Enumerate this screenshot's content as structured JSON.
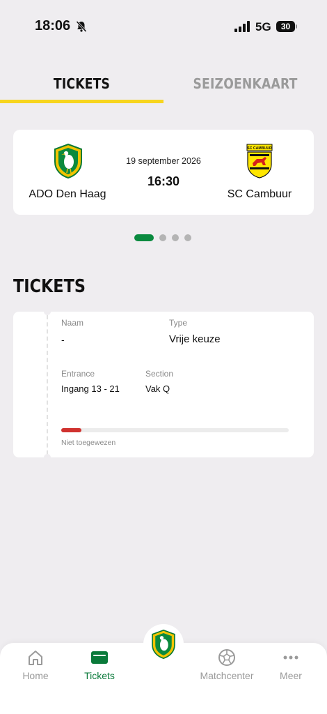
{
  "status_bar": {
    "time": "18:06",
    "network": "5G",
    "battery": "30",
    "icons": [
      "bell-slash-icon",
      "signal-icon",
      "battery-icon"
    ]
  },
  "tabs": [
    {
      "label": "TICKETS",
      "active": true
    },
    {
      "label": "SEIZOENKAART",
      "active": false
    }
  ],
  "match": {
    "home_team": "ADO Den Haag",
    "away_team": "SC Cambuur",
    "date": "19 september 2026",
    "time": "16:30",
    "away_logo_text": "SC CAMBUUR"
  },
  "pagination": {
    "count": 4,
    "active": 0
  },
  "tickets_section": {
    "title": "TICKETS",
    "ticket": {
      "naam_label": "Naam",
      "naam_value": "-",
      "type_label": "Type",
      "type_value": "Vrije keuze",
      "entrance_label": "Entrance",
      "entrance_value": "Ingang 13 - 21",
      "section_label": "Section",
      "section_value": "Vak Q",
      "progress_fraction": 0.09,
      "status": "Niet toegewezen"
    }
  },
  "bottom_nav": {
    "items": [
      {
        "label": "Home",
        "icon": "home-icon",
        "active": false
      },
      {
        "label": "Tickets",
        "icon": "ticket-icon",
        "active": true
      },
      {
        "label": "Matchcenter",
        "icon": "football-icon",
        "active": false
      },
      {
        "label": "Meer",
        "icon": "more-icon",
        "active": false
      }
    ],
    "center_icon": "club-logo-icon"
  },
  "colors": {
    "accent_green": "#0a8a3f",
    "tab_yellow": "#f7d51f",
    "progress_red": "#d0322f",
    "background": "#efedf0"
  }
}
